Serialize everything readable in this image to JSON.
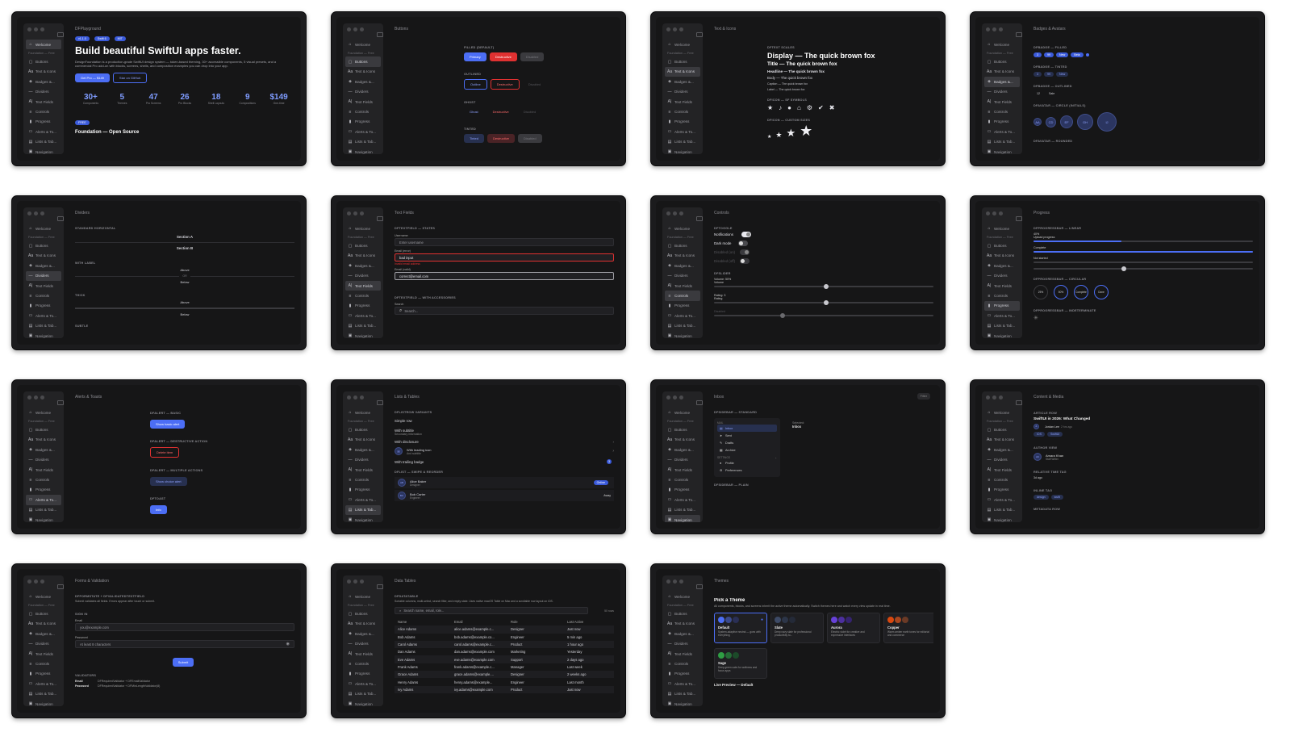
{
  "sidebar": {
    "welcome": "Welcome",
    "section": "Foundation — Free",
    "items": [
      {
        "label": "Buttons",
        "icon": "button-icon"
      },
      {
        "label": "Text & Icons",
        "icon": "text-icon"
      },
      {
        "label": "Badges &...",
        "icon": "badge-icon"
      },
      {
        "label": "Dividers",
        "icon": "divider-icon"
      },
      {
        "label": "Text Fields",
        "icon": "textfield-icon"
      },
      {
        "label": "Controls",
        "icon": "controls-icon"
      },
      {
        "label": "Progress",
        "icon": "progress-icon"
      },
      {
        "label": "Alerts & To...",
        "icon": "alert-icon"
      },
      {
        "label": "Lists & Tab...",
        "icon": "list-icon"
      },
      {
        "label": "Navigation",
        "icon": "navigation-icon"
      }
    ]
  },
  "windows": {
    "playground": {
      "title": "DFPlayground",
      "badges": [
        "v1.1.0",
        "Swift 6",
        "MIT"
      ],
      "headline": "Build beautiful SwiftUI apps faster.",
      "desc": "DesignFoundation is a production-grade SwiftUI design system — token-based theming, 30+ accessible components, 5 visual presets, and a commercial Pro add-on with blocks, screens, shells, and composition examples you can drop into your app.",
      "cta_primary": "Get Pro — $149",
      "cta_secondary": "Star on GitHub",
      "stats": [
        {
          "value": "30+",
          "label": "Components"
        },
        {
          "value": "5",
          "label": "Themes"
        },
        {
          "value": "47",
          "label": "Pro Screens"
        },
        {
          "value": "26",
          "label": "Pro Blocks"
        },
        {
          "value": "18",
          "label": "Shell Layouts"
        },
        {
          "value": "9",
          "label": "Compositions"
        },
        {
          "value": "$149",
          "label": "One-time"
        }
      ],
      "free_badge": "FREE",
      "footer": "Foundation — Open Source"
    },
    "buttons": {
      "title": "Buttons",
      "filled": "FILLED (DEFAULT)",
      "outlined": "OUTLINED",
      "ghost": "GHOST",
      "tinted": "TINTED",
      "primary": "Primary",
      "destructive": "Destructive",
      "disabled": "Disabled",
      "outline": "Outline",
      "ghost_label": "Ghost",
      "tinted_label": "Tinted"
    },
    "text": {
      "title": "Text & Icons",
      "scales": "DFTEXT SCALES",
      "display": "Display — The quick brown fox",
      "title_line": "Title — The quick brown fox",
      "headline": "Headline — The quick brown fox",
      "body": "Body — The quick brown fox",
      "caption": "Caption — The quick brown fox",
      "label": "Label — The quick brown fox",
      "sf_symbols": "DFICON — SF SYMBOLS",
      "custom_sizes": "DFICON — CUSTOM SIZES"
    },
    "badges": {
      "title": "Badges & Avatars",
      "filled": "DFBADGE — FILLED",
      "tinted": "DFBADGE — TINTED",
      "outlined": "DFBADGE — OUTLINED",
      "circle": "DFAVATAR — CIRCLE (INITIALS)",
      "rounded": "DFAVATAR — ROUNDED",
      "badge_vals": [
        "3",
        "99",
        "New",
        "Beta"
      ],
      "avatars": [
        "AA",
        "CD",
        "EF",
        "GH",
        "IJ"
      ],
      "outlined_vals": [
        "12",
        "Sale"
      ]
    },
    "dividers": {
      "title": "Dividers",
      "standard": "STANDARD HORIZONTAL",
      "section_a": "Section A",
      "section_b": "Section B",
      "with_label": "WITH LABEL",
      "above": "Above",
      "or": "OR",
      "below": "Below",
      "thick": "THICK",
      "subtle": "SUBTLE"
    },
    "textfields": {
      "title": "Text Fields",
      "states": "DFTEXTFIELD — STATES",
      "username_label": "Username",
      "username_ph": "Enter username",
      "error_label": "Email (error)",
      "error_val": "bad input",
      "error_msg": "Invalid email address",
      "valid_label": "Email (valid)",
      "valid_val": "correct@email.com",
      "accessories": "DFTEXTFIELD — WITH ACCESSORIES",
      "search_label": "Search",
      "search_ph": "Search..."
    },
    "controls": {
      "title": "Controls",
      "toggle": "DFTOGGLE",
      "notifications": "Notifications",
      "dark_mode": "Dark mode",
      "disabled_on": "Disabled (on)",
      "disabled_off": "Disabled (off)",
      "slider": "DFSLIDER",
      "volume_val": "Volume: 50%",
      "volume": "Volume",
      "rating_val": "Rating: 3",
      "rating": "Rating",
      "disabled": "Disabled"
    },
    "progress": {
      "title": "Progress",
      "linear": "DFPROGRESSBAR — LINEAR",
      "pct": "40%",
      "upload": "Upload progress",
      "complete": "Complete",
      "not_started": "Not started",
      "circular": "DFPROGRESSBAR — CIRCULAR",
      "circles": [
        "25%",
        "50%",
        "Complete",
        "Done"
      ],
      "indeterminate": "DFPROGRESSBAR — INDETERMINATE",
      "upload_fraction": 0.4,
      "complete_fraction": 1.0,
      "not_started_fraction": 0.0,
      "slider_fraction": 0.4
    },
    "alerts": {
      "title": "Alerts & Toasts",
      "basic": "DFALERT — BASIC",
      "show_basic": "Show basic alert",
      "destructive": "DFALERT — DESTRUCTIVE ACTION",
      "delete_item": "Delete item",
      "multiple": "DFALERT — MULTIPLE ACTIONS",
      "show_choice": "Show choice alert",
      "toast": "DFTOAST",
      "info": "Info"
    },
    "lists": {
      "title": "Lists & Tables",
      "row_variants": "DFLISTROW VARIANTS",
      "simple": "Simple row",
      "with_subtitle": "With subtitle",
      "secondary": "Secondary information",
      "with_disclosure": "With disclosure",
      "leading_icon": "With leading icon",
      "and_subtitle": "And subtitle",
      "trailing_badge": "With trailing badge",
      "badge_count": "3",
      "swipe": "DFLIST — SWIPE & REORDER",
      "alice": "Alice Baker",
      "alice_role": "Designer",
      "alice_status": "Online",
      "bob": "Bob Carter",
      "bob_role": "Engineer",
      "bob_status": "Away",
      "alice_initials": "AB",
      "bob_initials": "BC"
    },
    "inbox": {
      "title": "Inbox",
      "filter": "Filter",
      "sidebar_standard": "DFSIDEBAR — STANDARD",
      "mail": "MAIL",
      "inbox": "Inbox",
      "sent": "Sent",
      "drafts": "Drafts",
      "archive": "Archive",
      "settings": "SETTINGS",
      "profile": "Profile",
      "preferences": "Preferences",
      "selected_label": "Selected:",
      "selected_val": "Inbox",
      "sidebar_plain": "DFSIDEBAR — PLAIN"
    },
    "content": {
      "title": "Content & Media",
      "article": "ARTICLE ROW",
      "article_title": "SwiftUI in 2026: What Changed",
      "author": "Jordan Lee",
      "time": "2 hrs ago",
      "tags": [
        "iOS",
        "SwiftUI"
      ],
      "author_view": "AUTHOR VIEW",
      "author_name": "Amara Khan",
      "author_role": "Staff Writer",
      "author_initials": "AK",
      "relative_time": "RELATIVE TIME TAG",
      "relative_val": "3d ago",
      "inline_tag": "INLINE TAG",
      "inline_tags": [
        "design",
        "swift"
      ],
      "metadata": "METADATA ROW"
    },
    "forms": {
      "title": "Forms & Validation",
      "header": "DFFORMSTATE + DFVALIDATEDTEXTFIELD",
      "desc": "Submit validates all fields. Errors appear after touch or submit.",
      "sign_in": "SIGN IN",
      "email_label": "Email",
      "email_ph": "you@example.com",
      "password_label": "Password",
      "password_ph": "At least 8 characters",
      "submit": "Submit",
      "validators": "VALIDATORS",
      "email_val_key": "Email",
      "email_val": "DFRequiredValidator + DFEmailValidator",
      "pw_val_key": "Password",
      "pw_val": "DFRequiredValidator + DFMinLengthValidator(8)"
    },
    "datatables": {
      "title": "Data Tables",
      "header": "DFDATATABLE",
      "desc": "Sortable columns, multi-select, search filter, and empty state. Uses native macOS Table on Mac and a scrollable row layout on iOS.",
      "search_ph": "Search name, email, role...",
      "count": "50 rows",
      "columns": [
        "Name",
        "Email",
        "Role",
        "Last Active"
      ],
      "rows": [
        [
          "Alice Adams",
          "alice.adams@example.c...",
          "Designer",
          "Just now"
        ],
        [
          "Bob Adams",
          "bob.adams@example.co...",
          "Engineer",
          "5 min ago"
        ],
        [
          "Carol Adams",
          "carol.adams@example.c...",
          "Product",
          "1 hour ago"
        ],
        [
          "Dan Adams",
          "dan.adams@example.com",
          "Marketing",
          "Yesterday"
        ],
        [
          "Eve Adams",
          "eve.adams@example.com",
          "Support",
          "2 days ago"
        ],
        [
          "Frank Adams",
          "frank.adams@example.c...",
          "Manager",
          "Last week"
        ],
        [
          "Grace Adams",
          "grace.adams@example....",
          "Designer",
          "2 weeks ago"
        ],
        [
          "Henry Adams",
          "henry.adams@example...",
          "Engineer",
          "Last month"
        ],
        [
          "Ivy Adams",
          "ivy.adams@example.com",
          "Product",
          "Just now"
        ]
      ]
    },
    "themes": {
      "title": "Themes",
      "heading": "Pick a Theme",
      "desc": "All components, blocks, and screens inherit the active theme automatically. Switch themes here and watch every view update in real time.",
      "cards": [
        {
          "name": "Default",
          "desc": "System-adaptive neutral — goes with everything",
          "colors": [
            "#4c6ef5",
            "#3b4a8c",
            "#2a2f55"
          ]
        },
        {
          "name": "Slate",
          "desc": "Deep navy slate for professional productivity to...",
          "colors": [
            "#3d4a66",
            "#2c3548",
            "#242a38"
          ]
        },
        {
          "name": "Aurora",
          "desc": "Electric violet for creative and expressive interfaces",
          "colors": [
            "#6741d9",
            "#4c2f9e",
            "#352370"
          ]
        },
        {
          "name": "Copper",
          "desc": "Warm amber earth tones for editorial and commerce",
          "colors": [
            "#d9480f",
            "#a8461f",
            "#6b3a26"
          ]
        },
        {
          "name": "Sage",
          "desc": "Deep green calm for wellness and focus apps",
          "colors": [
            "#2f9e44",
            "#256b36",
            "#1c4a29"
          ]
        }
      ],
      "live_preview": "Live Preview — Default"
    }
  },
  "colors": {
    "accent": "#4c6ef5",
    "destructive": "#e03131",
    "bg": "#161617"
  }
}
